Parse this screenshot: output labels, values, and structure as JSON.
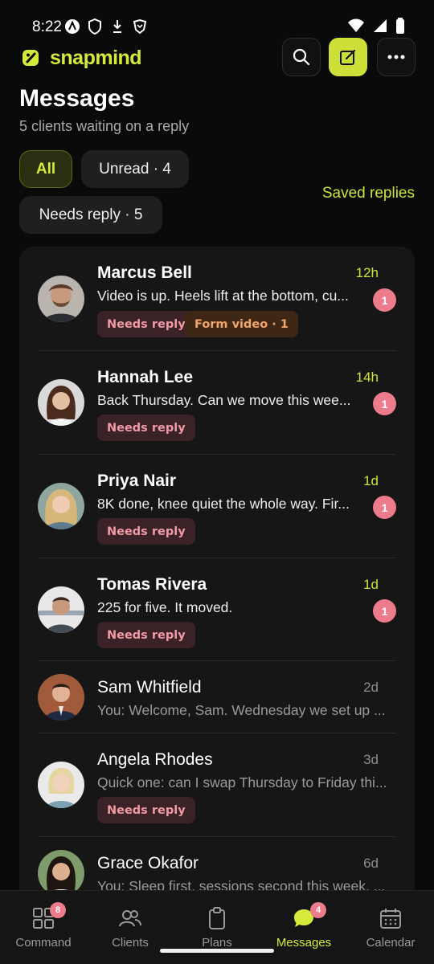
{
  "status_bar": {
    "time": "8:22",
    "icons": [
      "vpn-a-icon",
      "shield-icon",
      "download-icon",
      "brave-icon"
    ],
    "system_icons": [
      "wifi-icon",
      "cellular-icon",
      "battery-icon"
    ]
  },
  "header": {
    "app_name": "snapmind",
    "logo_icon": "snapmind-logo-icon",
    "buttons": [
      "search-icon",
      "compose-icon",
      "more-icon"
    ],
    "accent_color": "#cde03a"
  },
  "page": {
    "title": "Messages",
    "subtitle": "5 clients waiting on a reply"
  },
  "filters": [
    {
      "label": "All",
      "active": true
    },
    {
      "label": "Unread · 4",
      "active": false
    },
    {
      "label": "Needs reply · 5",
      "active": false
    }
  ],
  "saved_replies_label": "Saved replies",
  "messages": [
    {
      "name": "Marcus Bell",
      "time": "12h",
      "preview": "Video is up. Heels lift at the bottom, cu...",
      "unread": "1",
      "tags": [
        "Needs reply",
        "Form video · 1"
      ]
    },
    {
      "name": "Hannah Lee",
      "time": "14h",
      "preview": "Back Thursday. Can we move this wee...",
      "unread": "1",
      "tags": [
        "Needs reply"
      ]
    },
    {
      "name": "Priya Nair",
      "time": "1d",
      "preview": "8K done, knee quiet the whole way. Fir...",
      "unread": "1",
      "tags": [
        "Needs reply"
      ]
    },
    {
      "name": "Tomas Rivera",
      "time": "1d",
      "preview": "225 for five. It moved.",
      "unread": "1",
      "tags": [
        "Needs reply"
      ]
    },
    {
      "name": "Sam Whitfield",
      "time": "2d",
      "preview": "You: Welcome, Sam. Wednesday we set up ...",
      "unread": "",
      "tags": []
    },
    {
      "name": "Angela Rhodes",
      "time": "3d",
      "preview": "Quick one: can I swap Thursday to Friday thi...",
      "unread": "",
      "tags": [
        "Needs reply"
      ]
    },
    {
      "name": "Grace Okafor",
      "time": "6d",
      "preview": "You: Sleep first, sessions second this week. ...",
      "unread": "",
      "tags": []
    }
  ],
  "nav": [
    {
      "label": "Command",
      "icon": "grid-icon",
      "badge": "8",
      "active": false
    },
    {
      "label": "Clients",
      "icon": "people-icon",
      "badge": "",
      "active": false
    },
    {
      "label": "Plans",
      "icon": "clipboard-icon",
      "badge": "",
      "active": false
    },
    {
      "label": "Messages",
      "icon": "chat-icon",
      "badge": "4",
      "active": true
    },
    {
      "label": "Calendar",
      "icon": "calendar-icon",
      "badge": "",
      "active": false
    }
  ]
}
